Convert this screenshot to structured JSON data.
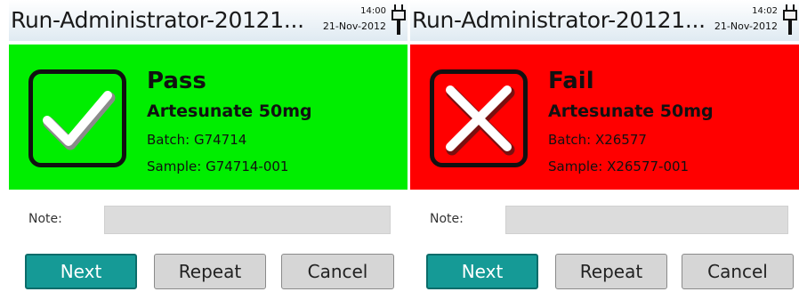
{
  "panels": [
    {
      "title": "Run-Administrator-20121...",
      "time": "14:00",
      "date": "21-Nov-2012",
      "result": {
        "status": "Pass",
        "product": "Artesunate 50mg",
        "batch": "Batch: G74714",
        "sample": "Sample: G74714-001",
        "icon": "check-icon",
        "background_color": "#00ee00"
      },
      "note_label": "Note:",
      "note_value": "",
      "buttons": {
        "next": "Next",
        "repeat": "Repeat",
        "cancel": "Cancel"
      }
    },
    {
      "title": "Run-Administrator-20121...",
      "time": "14:02",
      "date": "21-Nov-2012",
      "result": {
        "status": "Fail",
        "product": "Artesunate 50mg",
        "batch": "Batch: X26577",
        "sample": "Sample: X26577-001",
        "icon": "cross-icon",
        "background_color": "#ff0000"
      },
      "note_label": "Note:",
      "note_value": "",
      "buttons": {
        "next": "Next",
        "repeat": "Repeat",
        "cancel": "Cancel"
      }
    }
  ],
  "colors": {
    "pass": "#00ee00",
    "fail": "#ff0000",
    "next_button": "#159a96",
    "secondary_button": "#d6d6d6"
  }
}
